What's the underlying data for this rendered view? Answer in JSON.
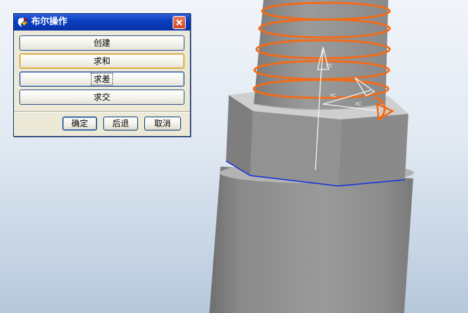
{
  "dialog": {
    "title": "布尔操作",
    "operations": [
      {
        "label": "创建"
      },
      {
        "label": "求和"
      },
      {
        "label": "求差"
      },
      {
        "label": "求交"
      }
    ],
    "ok_label": "确定",
    "back_label": "后退",
    "cancel_label": "取消"
  },
  "viewport": {
    "triad_labels": {
      "z": "ZC",
      "y": "YC",
      "x": "XC"
    },
    "colors": {
      "part_gray": "#8c8c8c",
      "helix_orange": "#f26b18",
      "edge_blue": "#1030e0",
      "triad_orange": "#f06a10"
    }
  },
  "icons": {
    "app_icon": "nx-logo-icon",
    "close_icon": "close-icon"
  }
}
